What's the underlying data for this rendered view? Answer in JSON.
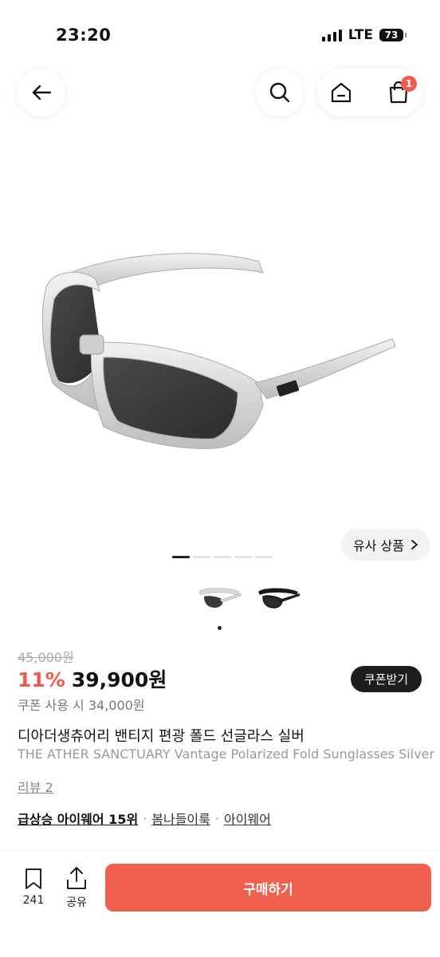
{
  "status_bar": {
    "time": "23:20",
    "network": "LTE",
    "battery": "73"
  },
  "nav": {
    "back_icon": "arrow-left-icon",
    "search_icon": "search-icon",
    "home_icon": "home-icon",
    "cart_icon": "shopping-bag-icon",
    "cart_badge": "1"
  },
  "gallery": {
    "similar_label": "유사 상품",
    "slides_total": 5,
    "slide_current": 1,
    "thumbnails": [
      "silver",
      "black"
    ],
    "thumbnail_selected": 1
  },
  "price": {
    "original": "45,000원",
    "discount": "11%",
    "sale": "39,900원",
    "coupon_button": "쿠폰받기",
    "coupon_price": "쿠폰 사용 시 34,000원"
  },
  "product": {
    "title_ko": "디아더생츄어리 밴티지 편광 폴드 선글라스 실버",
    "title_en": "THE ATHER SANCTUARY Vantage Polarized Fold Sunglasses Silver",
    "review_link": "리뷰 2"
  },
  "tags": [
    "급상승 아이웨어 15위",
    "봄나들이룩",
    "아이웨어"
  ],
  "tag_separator": "·",
  "bottom_bar": {
    "bookmark_count": "241",
    "share_label": "공유",
    "buy_label": "구매하기"
  },
  "colors": {
    "accent": "#ee5a4f",
    "buy_button": "#f0604f",
    "coupon_button": "#1d1d1d"
  }
}
